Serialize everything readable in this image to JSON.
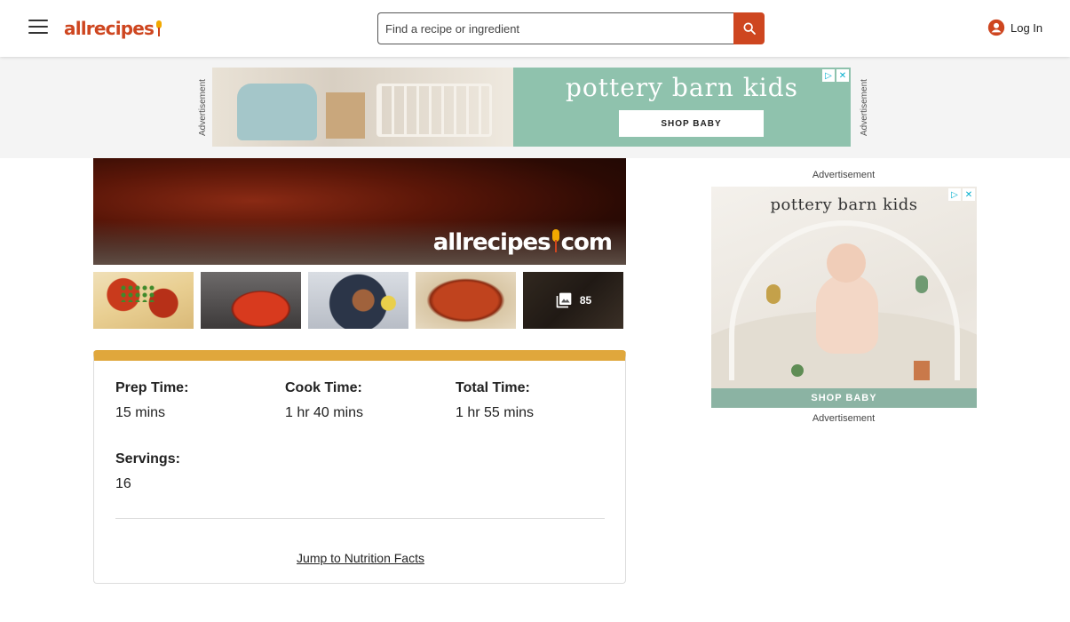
{
  "header": {
    "logo_text": "allrecipes",
    "search_placeholder": "Find a recipe or ingredient",
    "login_label": "Log In"
  },
  "top_ad": {
    "label_left": "Advertisement",
    "label_right": "Advertisement",
    "brand": "pottery barn kids",
    "cta": "SHOP BABY"
  },
  "video": {
    "watermark_left": "allrecipes",
    "watermark_right": "com"
  },
  "gallery": {
    "photo_count": "85"
  },
  "recipe_details": {
    "prep_label": "Prep Time:",
    "prep_value": "15 mins",
    "cook_label": "Cook Time:",
    "cook_value": "1 hr 40 mins",
    "total_label": "Total Time:",
    "total_value": "1 hr 55 mins",
    "servings_label": "Servings:",
    "servings_value": "16",
    "jump_link": "Jump to Nutrition Facts"
  },
  "side_ad": {
    "label_top": "Advertisement",
    "label_bottom": "Advertisement",
    "brand": "pottery barn kids",
    "cta": "SHOP BABY"
  },
  "colors": {
    "brand": "#ce4620",
    "accent": "#e0a73c",
    "ad_green": "#8fc2ad"
  }
}
